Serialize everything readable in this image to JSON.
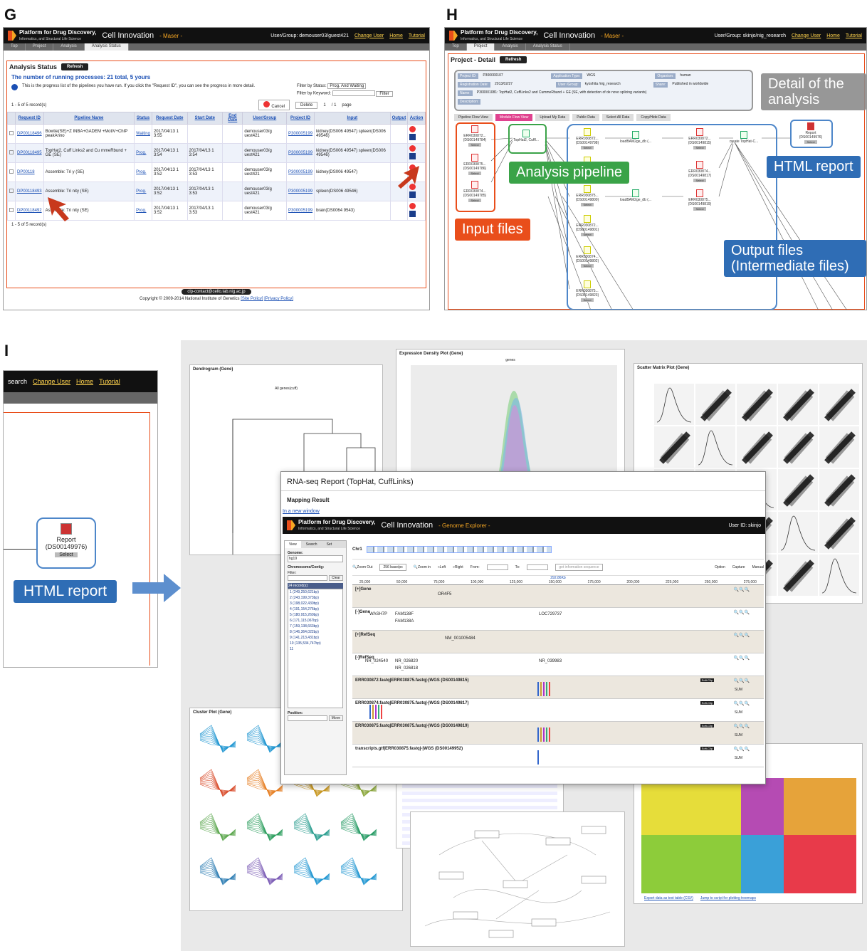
{
  "panels": {
    "g": "G",
    "h": "H",
    "i": "I"
  },
  "app": {
    "brand_line1": "Platform for Drug Discovery,",
    "brand_line2": "Informatics, and Structural Life Science",
    "brand_ci": "Cell Innovation",
    "maser": "- Maser -",
    "genome_explorer": "- Genome Explorer -",
    "change_user": "Change User",
    "home": "Home",
    "tutorial": "Tutorial",
    "search_frag": "search"
  },
  "g": {
    "user": "User/Group: demouser03/guest421",
    "tabs": [
      "Top",
      "Project",
      "Analysis",
      "Analysis Status"
    ],
    "title": "Analysis Status",
    "refresh": "Refresh",
    "running": "The number of running processes:  21 total,   5 yours",
    "info": "This is the progress list of the pipelines you have run. If you click the \"Request ID\", you can see the progress in more detail.",
    "filter_status_label": "Filter by Status:",
    "filter_status_value": "Prog. And Waiting",
    "filter_keyword_label": "Filter by Keyword:",
    "filter_btn": "Filter",
    "records": "1 - 5 of 5 record(s)",
    "cancel": "Cancel",
    "delete": "Delete",
    "page": "1",
    "pages": "/ 1",
    "page_word": "page",
    "columns": [
      "Request ID",
      "Pipeline Name",
      "Status",
      "Request Date",
      "Start Date",
      "End Date",
      "User/Group",
      "Project ID",
      "Input",
      "Output",
      "Action"
    ],
    "rows": [
      {
        "id": "DP00118496",
        "pipeline": "Bowtie(SE)+Z INBA+GADEM +MotiV+ChIP peakAnno",
        "status": "Waiting",
        "req": "2017/04/13 1 3:55",
        "start": "",
        "end": "",
        "user": "demouser03/g uest421",
        "project": "P300005199",
        "input": "kidney(DS006 49547) spleen(DS006 49546)"
      },
      {
        "id": "DP00118495",
        "pipeline": "TopHat2, Cuff Links2 and Cu mmeRbund + GE (SE)",
        "status": "Prog.",
        "req": "2017/04/13 1 3:54",
        "start": "2017/04/13 1 3:54",
        "end": "",
        "user": "demouser03/g uest421",
        "project": "P300005199",
        "input": "kidney(DS006 49547) spleen(DS006 49546)"
      },
      {
        "id": "DP00118",
        "pipeline": "Assemble: Tri y (SE)",
        "status": "Prog.",
        "req": "2017/04/13 1 3:52",
        "start": "2017/04/13 1 3:53",
        "end": "",
        "user": "demouser03/g uest421",
        "project": "P300005199",
        "input": "kidney(DS006 49547)"
      },
      {
        "id": "DP00118493",
        "pipeline": "Assemble: Tri nity (SE)",
        "status": "Prog.",
        "req": "2017/04/13 1 3:52",
        "start": "2017/04/13 1 3:53",
        "end": "",
        "user": "demouser03/g uest421",
        "project": "P300005199",
        "input": "spleen(DS006 49546)"
      },
      {
        "id": "DP00118492",
        "pipeline": "Assemble: Tri nity (SE)",
        "status": "Prog.",
        "req": "2017/04/13 1 3:52",
        "start": "2017/04/13 1 3:53",
        "end": "",
        "user": "demouser03/g uest421",
        "project": "P300005199",
        "input": "brain(DS0064 9543)"
      }
    ],
    "contact": "clp-contact@cello.lab.nig.ac.jp",
    "copyright": "Copyright © 2009-2014 National Institute of Genetics",
    "site_policy": "[Site Policy]",
    "privacy_policy": "[Privacy Policy]"
  },
  "h": {
    "user": "User/Group: skinjo/nig_research",
    "tabs": [
      "Top",
      "Project",
      "Analysis",
      "Analysis Status"
    ],
    "title": "Project - Detail",
    "refresh": "Refresh",
    "fields": {
      "project_id_l": "Project ID:",
      "project_id": "P300000107",
      "app_type_l": "Application Type:",
      "app_type": "WGS",
      "organism_l": "Organism:",
      "organism": "human",
      "reg_date_l": "Registration Date:",
      "reg_date": "2013/02/27",
      "user_l": "User /Group:",
      "user": "kyoshita /nig_research",
      "share_l": "Share:",
      "share": "Published in worldwide",
      "name_l": "Name:",
      "name": "P300001081: TopHat2, CuffLinks2 and CummeRbund + GE (SE, with detection of de novo splicing variants)",
      "desc_l": "Description:"
    },
    "toolbar": [
      "Pipeline Flow View",
      "Module Flow View",
      "Upload My Data",
      "Public Data",
      "Select All Data",
      "Copy/Hide Data"
    ],
    "callouts": {
      "detail": "Detail of the analysis",
      "pipeline": "Analysis pipeline",
      "html": "HTML report",
      "input": "Input files",
      "output": "Output files (Intermediate files)"
    },
    "inputs": [
      "ERR030872... (DS00149784)",
      "ERR030875... (DS00149786)",
      "ERR030874... (DS00149785)"
    ],
    "tophat": "TopHat2, Cuffl...",
    "outputs": [
      "ERR030872... (DS00149798)",
      "ERR030873... (DS00149799)",
      "ERR030875... (DS00149800)",
      "ERR030872... (DS00149801)",
      "ERR030874... (DS00149802)",
      "ERR030875... (DS00149823)"
    ],
    "load": "loadBAM2ge_db (...",
    "right_nodes": [
      "ERR030872... (DS00149815)",
      "ERR030874... (DS00149817)",
      "ERR030875... (DS00149819)"
    ],
    "create": "create TopHat-C...",
    "report": "Report (DS00149976)",
    "select": "Select"
  },
  "i": {
    "report_node": "Report",
    "report_id": "(DS00149976)",
    "select": "Select",
    "html_callout": "HTML report",
    "dendro_title": "Dendrogram (Gene)",
    "dendro_sub": "All genes(cuff)",
    "density_title": "Expression Density Plot (Gene)",
    "density_sub": "genes",
    "scatter_title": "Scatter Matrix Plot (Gene)",
    "cluster_title": "Cluster Plot (Gene)",
    "report_title": "RNA-seq Report (TopHat, CuffLinks)",
    "mapping": "Mapping Result",
    "new_window": "In a new window",
    "user_id": "User ID: skinjo",
    "side_tabs": [
      "View",
      "Search",
      "Set"
    ],
    "genome_l": "Genome:",
    "genome": "hg19",
    "chrom_l": "Chromosome/Contig:",
    "filter_l": "Filter:",
    "clear": "Clear",
    "records": "24 record(s):",
    "chroms": [
      "1 (249,250,621bp)",
      "2 (243,199,373bp)",
      "3 (198,022,430bp)",
      "4 (191,154,276bp)",
      "5 (180,915,260bp)",
      "6 (171,115,067bp)",
      "7 (159,138,663bp)",
      "8 (146,364,022bp)",
      "9 (141,213,431bp)",
      "10 (135,534,747bp)",
      "11"
    ],
    "position_l": "Position:",
    "move": "Move",
    "chr": "Chr1",
    "zoom_out": "Zoom Out",
    "zoom_in": "Zoom in",
    "base": "256 base/px",
    "left": "Left",
    "right": "Right",
    "from_l": "From:",
    "to_l": "To:",
    "get_seq": "get information sequence",
    "option": "Option",
    "capture": "Capture",
    "manual": "Manual",
    "scale": [
      "25,000",
      "50,000",
      "75,000",
      "100,000",
      "125,000",
      "150,000",
      "175,000",
      "200,000",
      "225,000",
      "250,000",
      "275,000"
    ],
    "ruler_mid": "292.86Kb",
    "tracks": [
      "[+]Gene",
      "[-]Gene",
      "[+]RefSeq",
      "[-]RefSeq",
      "ERR030872.fastq|ERR030875.fastq|-|WGS (DS00149815)",
      "ERR030874.fastq|ERR030875.fastq|-|WGS (DS00149817)",
      "ERR030875.fastq|ERR030875.fastq|-|WGS (DS00149819)",
      "transcripts.gtf|ERR030875.fastq|-|WGS (DS00149952)"
    ],
    "genes": [
      "OR4F5",
      "WASH7P",
      "FAM138F",
      "FAM138A",
      "LOC729737",
      "NM_001005484",
      "NR_024540",
      "NR_026820",
      "NR_026818",
      "NR_039983"
    ],
    "sum": "SUM",
    "soft_clip": "Soft-Clip",
    "treemap_foot1": "Export data as text table (CSV)",
    "treemap_foot2": "Jump to script for plotting treemaps"
  }
}
